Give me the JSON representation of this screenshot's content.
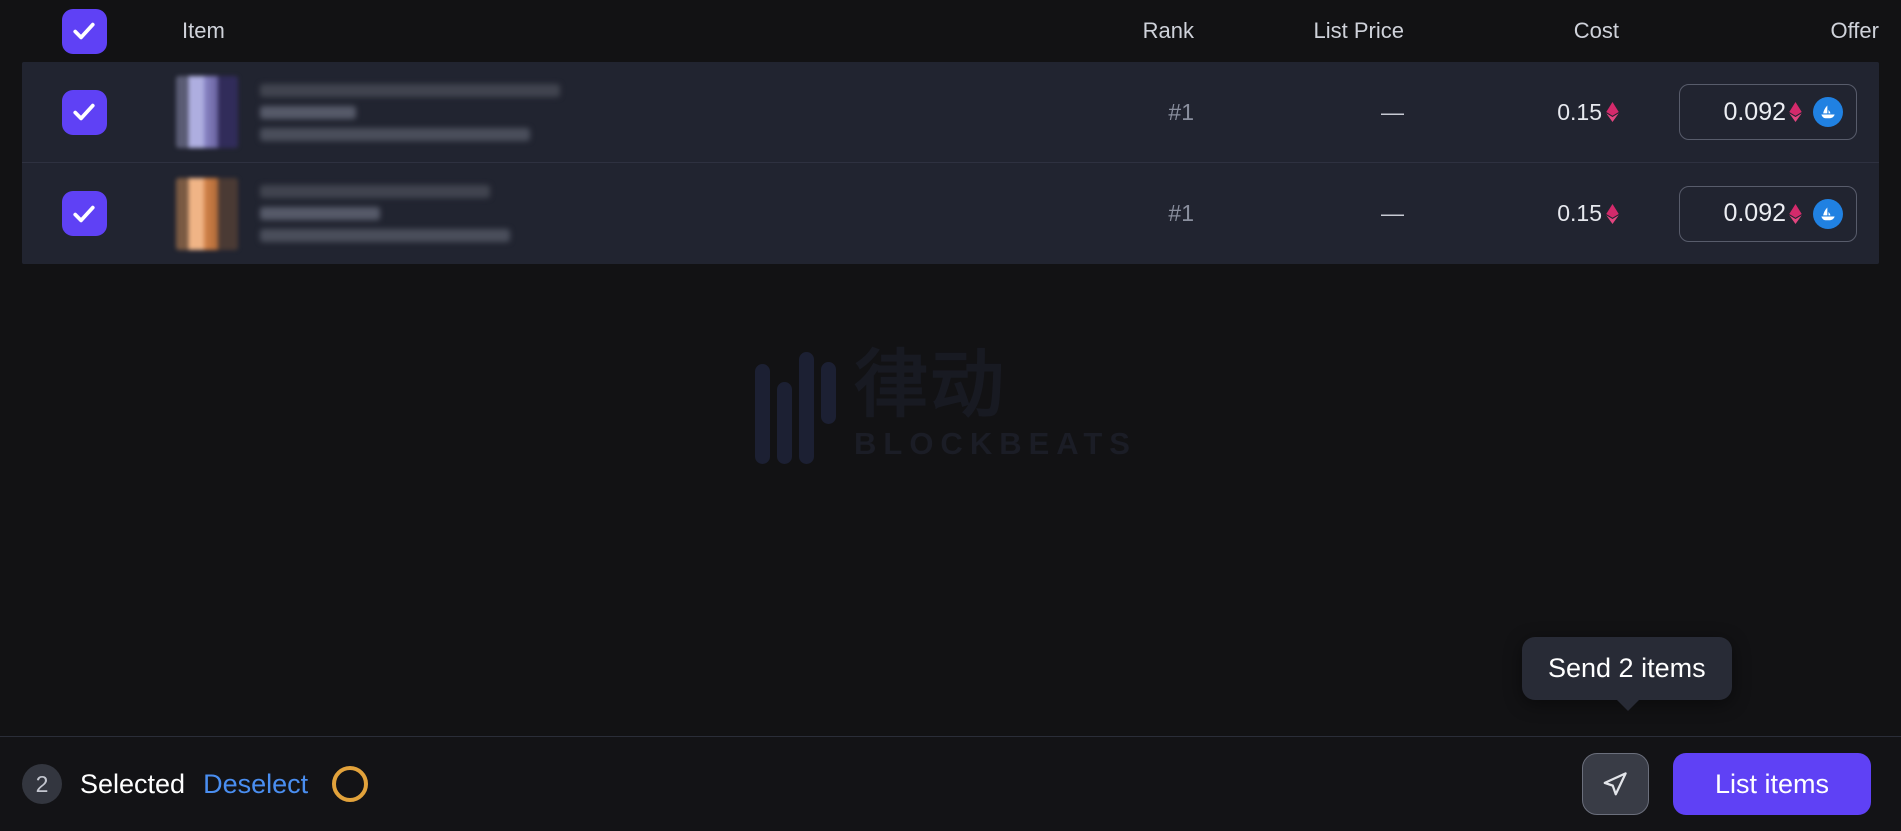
{
  "table": {
    "columns": {
      "item": "Item",
      "rank": "Rank",
      "list_price": "List Price",
      "cost": "Cost",
      "offer": "Offer"
    },
    "select_all_checked": true,
    "rows": [
      {
        "selected": true,
        "name": "",
        "rank": "#1",
        "list_price": "—",
        "cost": "0.15",
        "cost_currency_icon": "ethereum-icon",
        "offer": "0.092",
        "offer_currency_icon": "ethereum-icon",
        "marketplace_icon": "opensea-icon"
      },
      {
        "selected": true,
        "name": "",
        "rank": "#1",
        "list_price": "—",
        "cost": "0.15",
        "cost_currency_icon": "ethereum-icon",
        "offer": "0.092",
        "offer_currency_icon": "ethereum-icon",
        "marketplace_icon": "opensea-icon"
      }
    ]
  },
  "watermark": {
    "cn_text": "律动",
    "en_text": "BLOCKBEATS"
  },
  "tooltip": {
    "text": "Send 2 items"
  },
  "bottom_bar": {
    "count": "2",
    "selected_label": "Selected",
    "deselect_label": "Deselect",
    "loading_icon": "gold-ring-icon",
    "send_icon": "send-plane-icon",
    "list_items_label": "List items"
  },
  "colors": {
    "accent_purple": "#5f41f5",
    "link_blue": "#4a8ef0",
    "eth_pink": "#d42a6b",
    "opensea_blue": "#2081e2",
    "gold_ring": "#e2a23b",
    "row_bg": "#212430",
    "page_bg": "#121214"
  }
}
